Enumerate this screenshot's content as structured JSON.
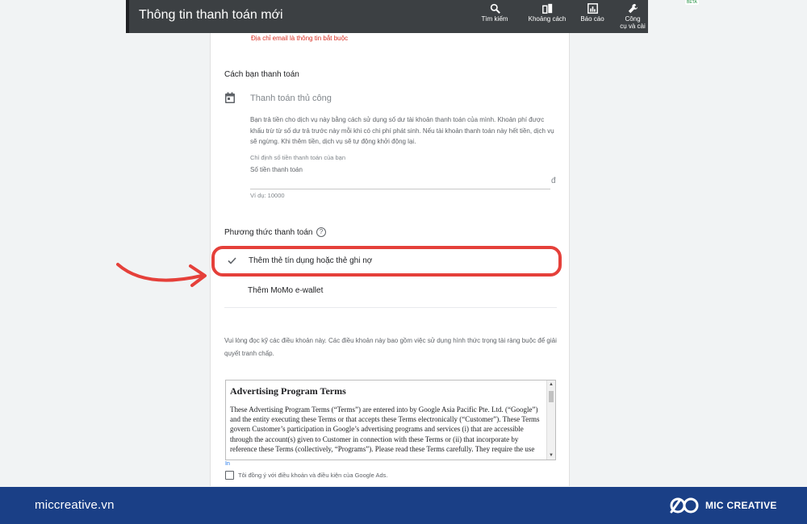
{
  "header": {
    "title": "Thông tin thanh toán mới",
    "tools": [
      {
        "icon": "search-icon",
        "label": "Tìm kiếm"
      },
      {
        "icon": "columns-icon",
        "label": "Khoảng cách"
      },
      {
        "icon": "chart-icon",
        "label": "Báo cáo"
      },
      {
        "icon": "wrench-icon",
        "label": "Công\ncụ và cài"
      }
    ],
    "beta": "BETA"
  },
  "form": {
    "email_required": "Địa chỉ email là thông tin bắt buộc",
    "how_you_pay": "Cách bạn thanh toán",
    "manual_payment": "Thanh toán thủ công",
    "manual_description": "Bạn trả tiền cho dịch vụ này bằng cách sử dụng số dư tài khoản thanh toán của mình. Khoản phí được khấu trừ từ số dư trả trước này mỗi khi có chi phí phát sinh. Nếu tài khoản thanh toán này hết tiền, dịch vụ sẽ ngừng. Khi thêm tiền, dịch vụ sẽ tự động khởi động lại.",
    "amount_hint": "Chỉ định số tiền thanh toán của bạn",
    "amount_label": "Số tiền thanh toán",
    "currency": "đ",
    "amount_example": "Ví dụ: 10000",
    "payment_method": "Phương thức thanh toán",
    "option_card": "Thêm thẻ tín dụng hoặc thẻ ghi nợ",
    "option_momo": "Thêm MoMo e-wallet",
    "terms_intro": "Vui lòng đọc kỹ các điều khoản này. Các điều khoản này bao gồm việc sử dụng hình thức trọng tài ràng buộc để giải quyết tranh chấp.",
    "terms_title": "Advertising Program Terms",
    "terms_text": "These Advertising Program Terms (“Terms”) are entered into by Google Asia Pacific Pte. Ltd. (“Google”) and the entity executing these Terms or that accepts these Terms electronically (“Customer”). These Terms govern Customer’s participation in Google’s advertising programs and services (i) that are accessible through the account(s) given to Customer in connection with these Terms or (ii) that incorporate by reference these Terms (collectively, “Programs”). Please read these Terms carefully. They require the use",
    "in_link": "In",
    "agree_label": "Tôi đồng ý với điều khoản và điều kiện của Google Ads."
  },
  "footer": {
    "site": "miccreative.vn",
    "brand": "MIC CREATIVE"
  },
  "colors": {
    "highlight": "#e5403a",
    "footer_bg": "#1a3f86",
    "header_bg": "#3c4043"
  }
}
